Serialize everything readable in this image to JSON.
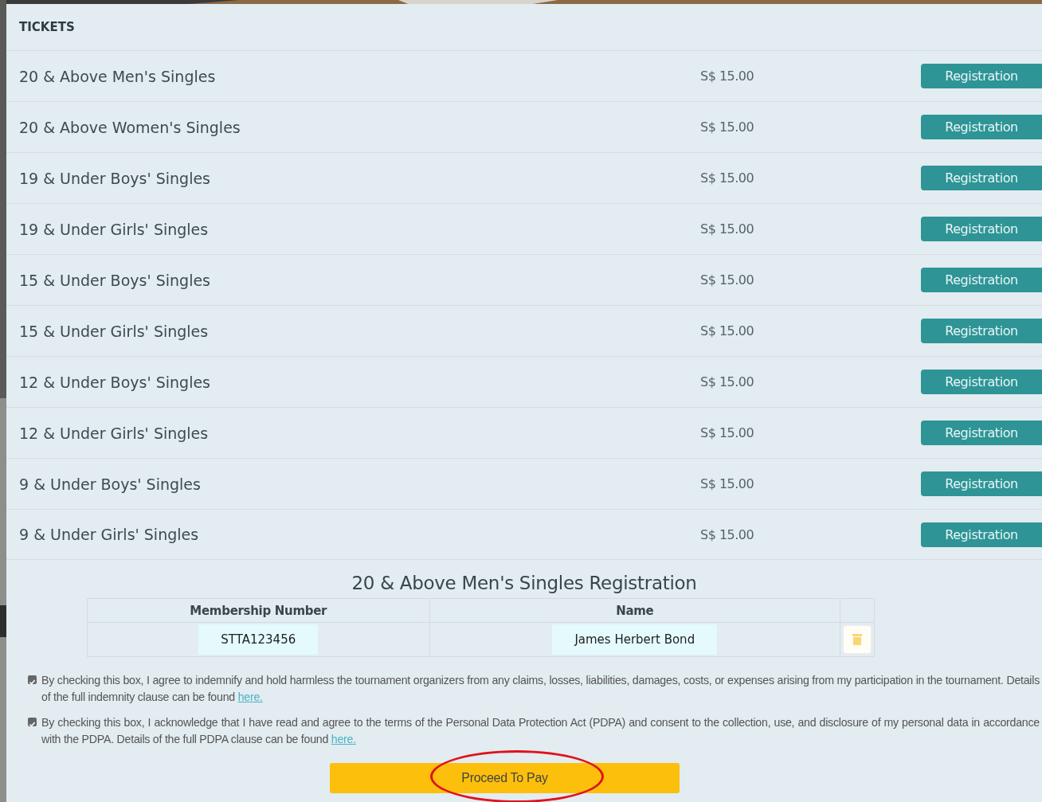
{
  "section_title": "TICKETS",
  "tickets": [
    {
      "name": "20 & Above Men's Singles",
      "price": "S$ 15.00",
      "button": "Registration"
    },
    {
      "name": "20 & Above Women's Singles",
      "price": "S$ 15.00",
      "button": "Registration"
    },
    {
      "name": "19 & Under Boys' Singles",
      "price": "S$ 15.00",
      "button": "Registration"
    },
    {
      "name": "19 & Under Girls' Singles",
      "price": "S$ 15.00",
      "button": "Registration"
    },
    {
      "name": "15 & Under Boys' Singles",
      "price": "S$ 15.00",
      "button": "Registration"
    },
    {
      "name": "15 & Under Girls' Singles",
      "price": "S$ 15.00",
      "button": "Registration"
    },
    {
      "name": "12 & Under Boys' Singles",
      "price": "S$ 15.00",
      "button": "Registration"
    },
    {
      "name": "12 & Under Girls' Singles",
      "price": "S$ 15.00",
      "button": "Registration"
    },
    {
      "name": "9 & Under Boys' Singles",
      "price": "S$ 15.00",
      "button": "Registration"
    },
    {
      "name": "9 & Under Girls' Singles",
      "price": "S$ 15.00",
      "button": "Registration"
    }
  ],
  "registration": {
    "title": "20 & Above Men's Singles Registration",
    "columns": [
      "Membership Number",
      "Name"
    ],
    "rows": [
      {
        "membership_number": "STTA123456",
        "name": "James Herbert Bond"
      }
    ]
  },
  "consents": [
    {
      "checked": true,
      "text": "By checking this box, I agree to indemnify and hold harmless the tournament organizers from any claims, losses, liabilities, damages, costs, or expenses arising from my participation in the tournament. Details of the full indemnity clause can be found ",
      "link": "here."
    },
    {
      "checked": true,
      "text": "By checking this box, I acknowledge that I have read and agree to the terms of the Personal Data Protection Act (PDPA) and consent to the collection, use, and disclosure of my personal data in accordance with the PDPA. Details of the full PDPA clause can be found ",
      "link": "here."
    }
  ],
  "pay_button": {
    "label": "Proceed To Pay",
    "highlighted": true
  }
}
